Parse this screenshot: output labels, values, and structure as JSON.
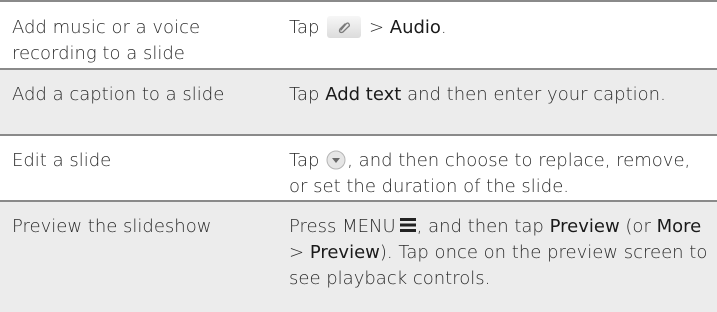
{
  "rows": [
    {
      "task": "Add music or a voice recording to a slide",
      "action": {
        "prefix": "Tap",
        "icon": "attach-icon",
        "mid": " > ",
        "bold1": "Audio",
        "suffix": "."
      }
    },
    {
      "task": "Add a caption to a slide",
      "action": {
        "prefix": "Tap",
        "bold1": "Add text",
        "suffix": "and then enter your caption."
      }
    },
    {
      "task": "Edit a slide",
      "action": {
        "prefix": "Tap",
        "icon": "dropdown-arrow-icon",
        "suffix": ", and then choose to replace, remove, or set the duration of the slide."
      }
    },
    {
      "task": "Preview the slideshow",
      "action": {
        "prefix": "Press MENU",
        "icon": "menu-icon",
        "mid": ", and then tap",
        "bold1": "Preview",
        "mid2": "(or",
        "bold2": "More",
        "mid3": " > ",
        "bold3": "Preview",
        "suffix": "). Tap once on the preview screen to see playback controls."
      }
    }
  ],
  "colors": {
    "row_shade": "#ececec",
    "divider": "#8a8a8a",
    "text": "#2b2b2b"
  }
}
